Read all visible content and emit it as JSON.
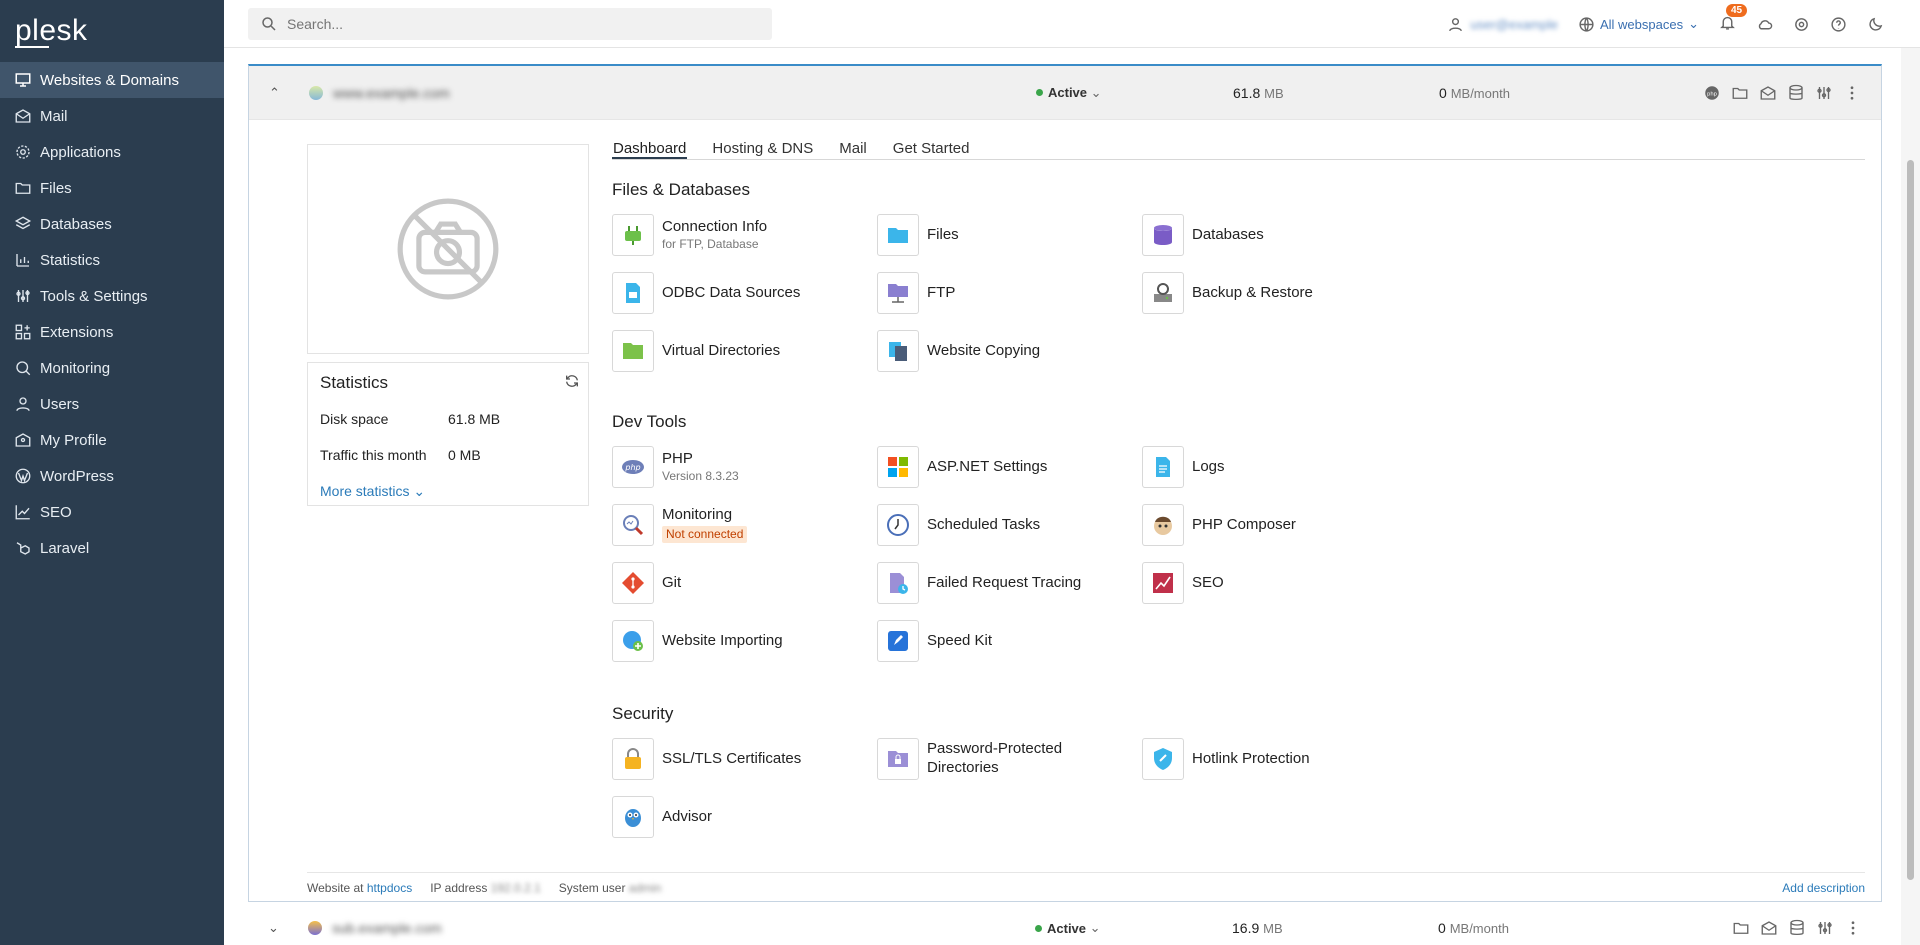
{
  "brand": {
    "logo": "plesk"
  },
  "sidebar": {
    "items": [
      {
        "label": "Websites & Domains",
        "icon": "monitor-icon",
        "active": true
      },
      {
        "label": "Mail",
        "icon": "mail-icon"
      },
      {
        "label": "Applications",
        "icon": "gear-icon"
      },
      {
        "label": "Files",
        "icon": "folder-icon"
      },
      {
        "label": "Databases",
        "icon": "layers-icon"
      },
      {
        "label": "Statistics",
        "icon": "bar-chart-icon"
      },
      {
        "label": "Tools & Settings",
        "icon": "sliders-icon"
      },
      {
        "label": "Extensions",
        "icon": "grid-plus-icon"
      },
      {
        "label": "Monitoring",
        "icon": "magnifier-icon"
      },
      {
        "label": "Users",
        "icon": "user-icon"
      },
      {
        "label": "My Profile",
        "icon": "id-card-icon"
      },
      {
        "label": "WordPress",
        "icon": "wordpress-icon"
      },
      {
        "label": "SEO",
        "icon": "trend-icon"
      },
      {
        "label": "Laravel",
        "icon": "laravel-icon"
      }
    ]
  },
  "topbar": {
    "search_placeholder": "Search...",
    "user_name": "user@example",
    "webspaces_label": "All webspaces",
    "notifications_count": "45"
  },
  "domain1": {
    "name": "www.example.com",
    "status": "Active",
    "disk_value": "61.8",
    "disk_unit": "MB",
    "traffic_value": "0",
    "traffic_unit": "MB/month"
  },
  "statistics": {
    "title": "Statistics",
    "disk_label": "Disk space",
    "disk_value": "61.8 MB",
    "traffic_label": "Traffic this month",
    "traffic_value": "0 MB",
    "more_label": "More statistics"
  },
  "tabs": [
    "Dashboard",
    "Hosting & DNS",
    "Mail",
    "Get Started"
  ],
  "sections": {
    "files_db": "Files & Databases",
    "dev_tools": "Dev Tools",
    "security": "Security"
  },
  "tools": {
    "connection_info": {
      "label": "Connection Info",
      "sub": "for FTP, Database"
    },
    "files": {
      "label": "Files"
    },
    "databases": {
      "label": "Databases"
    },
    "odbc": {
      "label": "ODBC Data Sources"
    },
    "ftp": {
      "label": "FTP"
    },
    "backup": {
      "label": "Backup & Restore"
    },
    "virtual_dirs": {
      "label": "Virtual Directories"
    },
    "website_copying": {
      "label": "Website Copying"
    },
    "php": {
      "label": "PHP",
      "sub": "Version 8.3.23"
    },
    "aspnet": {
      "label": "ASP.NET Settings"
    },
    "logs": {
      "label": "Logs"
    },
    "monitoring": {
      "label": "Monitoring",
      "sub": "Not connected"
    },
    "scheduled_tasks": {
      "label": "Scheduled Tasks"
    },
    "php_composer": {
      "label": "PHP Composer"
    },
    "git": {
      "label": "Git"
    },
    "failed_request": {
      "label": "Failed Request Tracing"
    },
    "seo": {
      "label": "SEO"
    },
    "website_importing": {
      "label": "Website Importing"
    },
    "speed_kit": {
      "label": "Speed Kit"
    },
    "ssl": {
      "label": "SSL/TLS Certificates"
    },
    "pwd_dirs": {
      "label": "Password-Protected Directories"
    },
    "hotlink": {
      "label": "Hotlink Protection"
    },
    "advisor": {
      "label": "Advisor"
    }
  },
  "footer": {
    "website_at": "Website at",
    "httpdocs": "httpdocs",
    "ip_label": "IP address",
    "ip_value": "192.0.2.1",
    "sysuser_label": "System user",
    "sysuser_value": "admin",
    "add_description": "Add description"
  },
  "domain2": {
    "name": "sub.example.com",
    "status": "Active",
    "disk_value": "16.9",
    "disk_unit": "MB",
    "traffic_value": "0",
    "traffic_unit": "MB/month"
  }
}
